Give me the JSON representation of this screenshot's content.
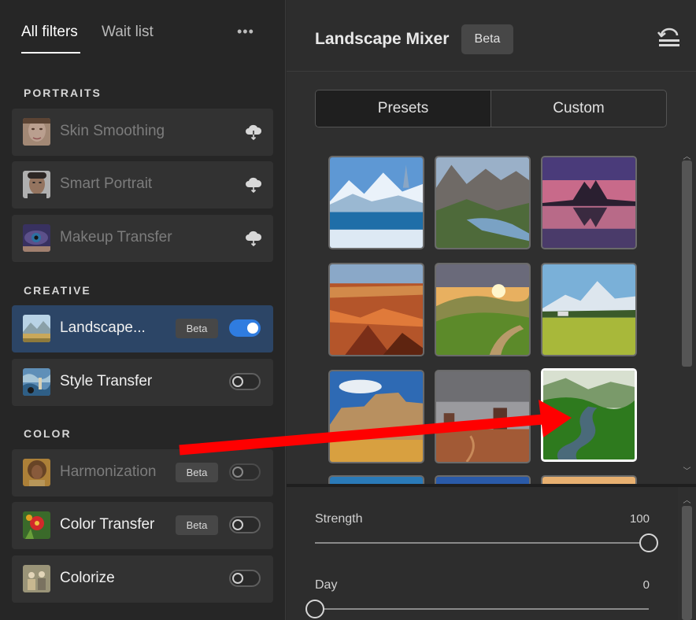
{
  "sidebar": {
    "tabs": [
      {
        "label": "All filters",
        "active": true
      },
      {
        "label": "Wait list",
        "active": false
      }
    ],
    "more_icon": "more-horizontal-icon",
    "sections": [
      {
        "title": "PORTRAITS"
      },
      {
        "title": "CREATIVE"
      },
      {
        "title": "COLOR"
      }
    ],
    "filters": [
      {
        "label": "Skin Smoothing",
        "state": "download",
        "thumb_icon": "face-thumbnail"
      },
      {
        "label": "Smart Portrait",
        "state": "download",
        "thumb_icon": "face-thumbnail"
      },
      {
        "label": "Makeup Transfer",
        "state": "download",
        "thumb_icon": "eye-thumbnail"
      },
      {
        "label": "Landscape...",
        "badge": "Beta",
        "toggle": true,
        "thumb_icon": "landscape-thumbnail"
      },
      {
        "label": "Style Transfer",
        "toggle": false,
        "thumb_icon": "painting-thumbnail"
      },
      {
        "label": "Harmonization",
        "badge": "Beta",
        "toggle": false,
        "disabled": true,
        "thumb_icon": "portrait-thumbnail"
      },
      {
        "label": "Color Transfer",
        "badge": "Beta",
        "toggle": false,
        "thumb_icon": "flower-thumbnail"
      },
      {
        "label": "Colorize",
        "toggle": false,
        "thumb_icon": "vintage-photo-thumbnail"
      }
    ]
  },
  "panel": {
    "title": "Landscape Mixer",
    "badge": "Beta",
    "reset_icon": "reset-icon",
    "segments": [
      {
        "label": "Presets",
        "active": true
      },
      {
        "label": "Custom",
        "active": false
      }
    ],
    "presets": [
      {
        "name": "winter-lake"
      },
      {
        "name": "mountain-valley-lake"
      },
      {
        "name": "sunset-mountain-reflection"
      },
      {
        "name": "canyon"
      },
      {
        "name": "sunrise-hills"
      },
      {
        "name": "green-meadow-mountains"
      },
      {
        "name": "desert-rocks"
      },
      {
        "name": "monument-valley"
      },
      {
        "name": "green-river-valley",
        "selected": true
      }
    ],
    "sliders": [
      {
        "label": "Strength",
        "value": "100",
        "fraction": 1.0
      },
      {
        "label": "Day",
        "value": "0",
        "fraction": 0.0
      }
    ]
  },
  "colors": {
    "accent": "#2f7ce0",
    "active_item_bg": "#2c4566",
    "annotation_arrow": "#ff0000"
  }
}
